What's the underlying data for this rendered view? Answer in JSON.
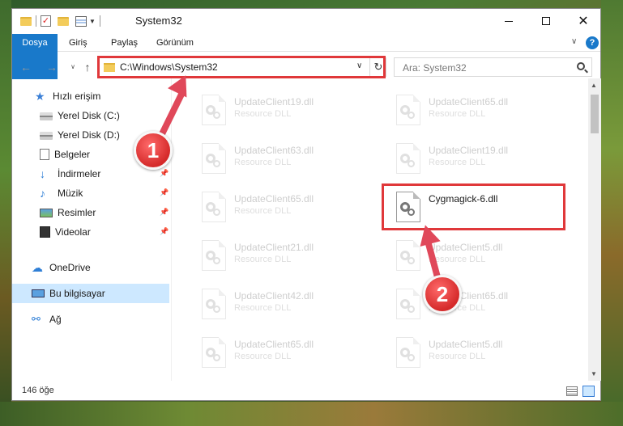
{
  "window": {
    "title": "System32"
  },
  "ribbon": {
    "tabs": [
      "Dosya",
      "Giriş",
      "Paylaş",
      "Görünüm"
    ],
    "help": "?"
  },
  "navigation": {
    "address": "C:\\Windows\\System32",
    "search_placeholder": "Ara: System32"
  },
  "sidebar": {
    "items": [
      {
        "label": "Hızlı erişim",
        "icon": "star-icon"
      },
      {
        "label": "Yerel Disk (C:)",
        "icon": "drive-icon"
      },
      {
        "label": "Yerel Disk (D:)",
        "icon": "drive-icon"
      },
      {
        "label": "Belgeler",
        "icon": "document-icon"
      },
      {
        "label": "İndirmeler",
        "icon": "download-icon"
      },
      {
        "label": "Müzik",
        "icon": "music-icon"
      },
      {
        "label": "Resimler",
        "icon": "pictures-icon"
      },
      {
        "label": "Videolar",
        "icon": "videos-icon"
      },
      {
        "label": "OneDrive",
        "icon": "cloud-icon"
      },
      {
        "label": "Bu bilgisayar",
        "icon": "computer-icon"
      },
      {
        "label": "Ağ",
        "icon": "network-icon"
      }
    ]
  },
  "files": [
    {
      "name": "UpdateClient19.dll",
      "type": "Resource DLL"
    },
    {
      "name": "UpdateClient65.dll",
      "type": "Resource DLL"
    },
    {
      "name": "UpdateClient63.dll",
      "type": "Resource DLL"
    },
    {
      "name": "UpdateClient19.dll",
      "type": "Resource DLL"
    },
    {
      "name": "UpdateClient65.dll",
      "type": "Resource DLL"
    },
    {
      "name": "Cygmagick-6.dll",
      "type": ""
    },
    {
      "name": "UpdateClient21.dll",
      "type": "Resource DLL"
    },
    {
      "name": "UpdateClient5.dll",
      "type": "Resource DLL"
    },
    {
      "name": "UpdateClient42.dll",
      "type": "Resource DLL"
    },
    {
      "name": "UpdateClient65.dll",
      "type": "Resource DLL"
    },
    {
      "name": "UpdateClient65.dll",
      "type": "Resource DLL"
    },
    {
      "name": "UpdateClient5.dll",
      "type": "Resource DLL"
    }
  ],
  "status": {
    "count": "146 öğe"
  },
  "annotations": {
    "badge1": "1",
    "badge2": "2",
    "color": "#e0383a"
  }
}
